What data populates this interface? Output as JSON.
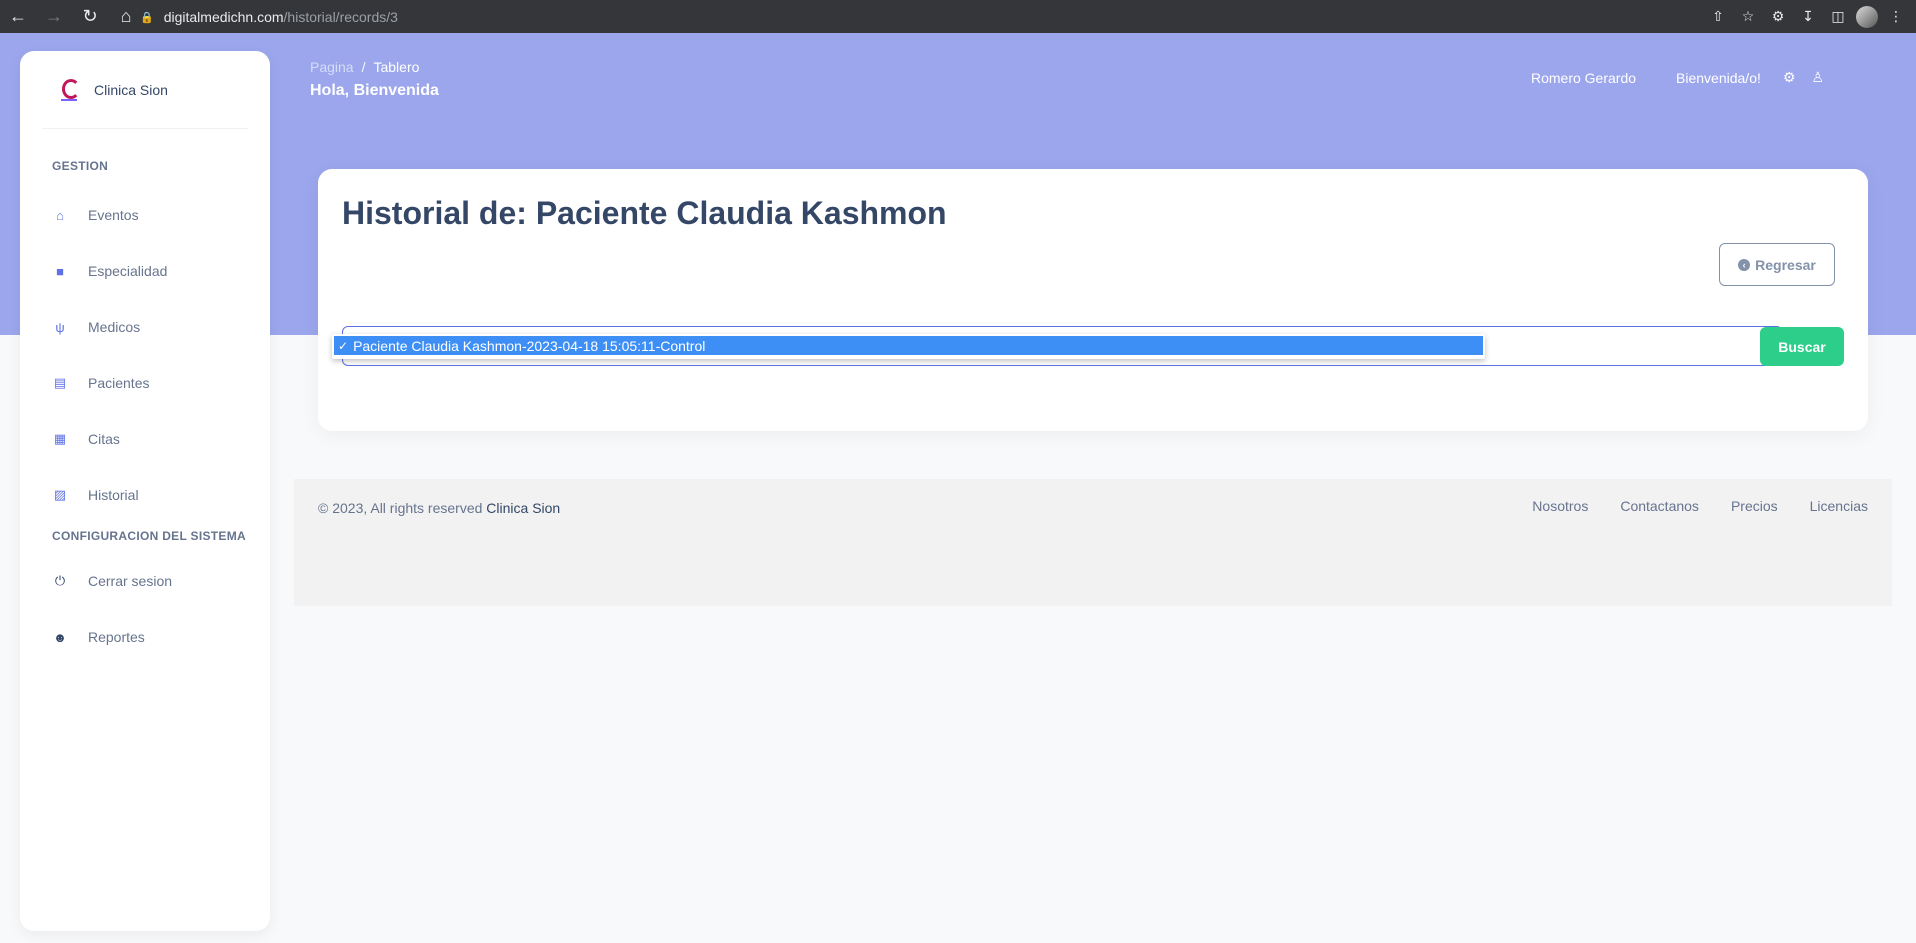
{
  "browser": {
    "url_host": "digitalmedichn.com",
    "url_path": "/historial/records/3"
  },
  "sidebar": {
    "brand": "Clinica Sion",
    "sections": [
      {
        "title": "GESTION"
      },
      {
        "title": "CONFIGURACION DEL SISTEMA"
      }
    ],
    "items": [
      {
        "label": "Eventos",
        "icon": "home-icon"
      },
      {
        "label": "Especialidad",
        "icon": "briefcase-icon"
      },
      {
        "label": "Medicos",
        "icon": "stethoscope-icon"
      },
      {
        "label": "Pacientes",
        "icon": "bed-icon"
      },
      {
        "label": "Citas",
        "icon": "calendar-icon"
      },
      {
        "label": "Historial",
        "icon": "address-book-icon"
      },
      {
        "label": "Cerrar sesion",
        "icon": "power-icon"
      },
      {
        "label": "Reportes",
        "icon": "user-gear-icon"
      }
    ]
  },
  "header": {
    "breadcrumb_root": "Pagina",
    "breadcrumb_sep": "/",
    "breadcrumb_current": "Tablero",
    "greeting": "Hola, Bienvenida",
    "user_name": "Romero Gerardo",
    "welcome": "Bienvenida/o!"
  },
  "main": {
    "title": "Historial de: Paciente Claudia Kashmon",
    "back_button": "Regresar",
    "select_option": "Paciente Claudia Kashmon-2023-04-18 15:05:11-Control",
    "search_button": "Buscar"
  },
  "footer": {
    "copyright": "© 2023, All rights reserved",
    "brand": "Clinica Sion",
    "links": [
      "Nosotros",
      "Contactanos",
      "Precios",
      "Licencias"
    ]
  },
  "colors": {
    "header_band": "#9ba6ec",
    "accent": "#5e72e4",
    "success": "#2dce89",
    "selected_option": "#3d8ff6"
  }
}
